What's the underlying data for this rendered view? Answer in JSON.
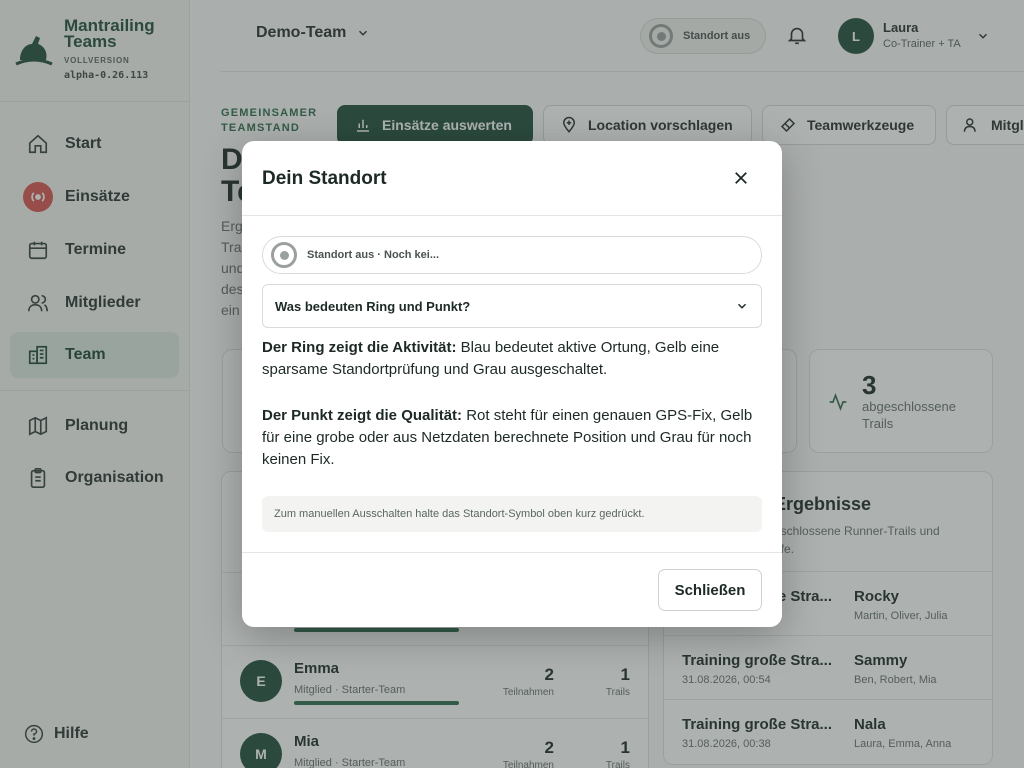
{
  "brand": {
    "title_line1": "Mantrailing",
    "title_line2": "Teams",
    "edition": "VOLLVERSION",
    "version": "alpha-0.26.113"
  },
  "sidebar": {
    "items": [
      {
        "label": "Start",
        "icon": "home-icon"
      },
      {
        "label": "Einsätze",
        "icon": "live-broadcast-icon"
      },
      {
        "label": "Termine",
        "icon": "calendar-icon"
      },
      {
        "label": "Mitglieder",
        "icon": "users-icon"
      },
      {
        "label": "Team",
        "icon": "building-icon",
        "active": true
      },
      {
        "label": "Planung",
        "icon": "map-icon"
      },
      {
        "label": "Organisation",
        "icon": "clipboard-icon"
      }
    ],
    "help_label": "Hilfe"
  },
  "topbar": {
    "team_name": "Demo-Team",
    "location_status": "Standort aus",
    "user_initial": "L",
    "user_name": "Laura",
    "user_role": "Co-Trainer + TA"
  },
  "main": {
    "eyebrow_line1": "GEMEINSAMER",
    "eyebrow_line2": "TEAMSTAND",
    "actions": [
      "Einsätze auswerten",
      "Location vorschlagen",
      "Teamwerkzeuge",
      "Mitgl"
    ],
    "title_line1": "D",
    "title_line2": "Te",
    "desc_lines": [
      "Erg",
      "Tra",
      "und",
      "des",
      "ein"
    ],
    "stat": {
      "value": "3",
      "label_line1": "abgeschlossene",
      "label_line2": "Trails"
    },
    "results": {
      "title": "Ergebnisse",
      "subtitle_line1": "eschlossene Runner-Trails und",
      "subtitle_line2": "ufe.",
      "rows": [
        {
          "title": "Training große Stra...",
          "date": "",
          "dog": "Rocky",
          "people": "Martin, Oliver, Julia"
        },
        {
          "title": "Training große Stra...",
          "date": "31.08.2026, 00:54",
          "dog": "Sammy",
          "people": "Ben, Robert, Mia"
        },
        {
          "title": "Training große Stra...",
          "date": "31.08.2026, 00:38",
          "dog": "Nala",
          "people": "Laura, Emma, Anna"
        }
      ]
    },
    "members": [
      {
        "initial": "E",
        "name": "Emma",
        "role": "Mitglied · Starter-Team",
        "participations": "2",
        "participations_label": "Teilnahmen",
        "trails": "1",
        "trails_label": "Trails"
      },
      {
        "initial": "M",
        "name": "Mia",
        "role": "Mitglied · Starter-Team",
        "participations": "2",
        "participations_label": "Teilnahmen",
        "trails": "1",
        "trails_label": "Trails"
      }
    ]
  },
  "modal": {
    "title": "Dein Standort",
    "status_text": "Standort aus · Noch kei...",
    "accordion_label": "Was bedeuten Ring und Punkt?",
    "ring_heading": "Der Ring zeigt die Aktivität:",
    "ring_text": " Blau bedeutet aktive Ortung, Gelb eine sparsame Standortprüfung und Grau ausgeschaltet.",
    "dot_heading": "Der Punkt zeigt die Qualität:",
    "dot_text": " Rot steht für einen genauen GPS-Fix, Gelb für eine grobe oder aus Netzdaten berechnete Position und Grau für noch keinen Fix.",
    "hint": "Zum manuellen Ausschalten halte das Standort-Symbol oben kurz gedrückt.",
    "close_label": "Schließen"
  },
  "colors": {
    "brand_green": "#1f4d3a",
    "alert_red": "#d9534f",
    "overlay": "rgba(60,70,66,0.42)"
  }
}
